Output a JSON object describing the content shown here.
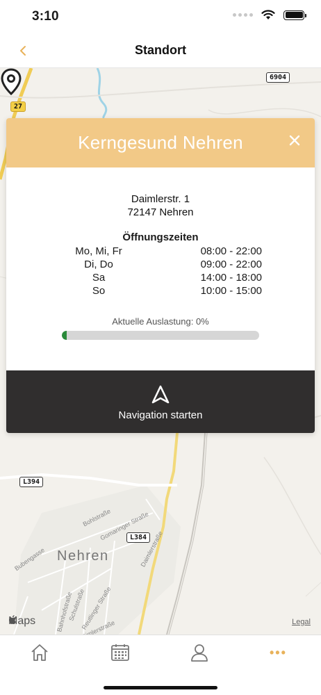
{
  "status": {
    "time": "3:10"
  },
  "nav": {
    "title": "Standort",
    "back_icon": "chevron-left-icon"
  },
  "map": {
    "roads": [
      "27",
      "6904",
      "L394",
      "L384"
    ],
    "town": "Nehren",
    "streets": [
      "Bohlstraße",
      "Gomaringer Straße",
      "Daimlerstraße",
      "Bubengasse",
      "Schulstraße",
      "Reutlinger Straße",
      "Bahnhofstraße",
      "Dimlerstraße"
    ],
    "attribution": "Maps",
    "legal": "Legal"
  },
  "card": {
    "title": "Kerngesund Nehren",
    "address_line1": "Daimlerstr. 1",
    "address_line2": "72147 Nehren",
    "hours_title": "Öffnungszeiten",
    "hours": [
      {
        "day": "Mo, Mi, Fr",
        "time": "08:00 - 22:00"
      },
      {
        "day": "Di, Do",
        "time": "09:00 - 22:00"
      },
      {
        "day": "Sa",
        "time": "14:00 - 18:00"
      },
      {
        "day": "So",
        "time": "10:00 - 15:00"
      }
    ],
    "load_label": "Aktuelle Auslastung: 0%",
    "load_percent": 0,
    "navigation_label": "Navigation starten"
  },
  "tabs": [
    {
      "name": "home",
      "icon": "home-icon"
    },
    {
      "name": "calendar",
      "icon": "calendar-icon"
    },
    {
      "name": "profile",
      "icon": "person-icon"
    },
    {
      "name": "more",
      "icon": "more-icon",
      "label": "•••"
    }
  ],
  "colors": {
    "accent": "#e8b25a",
    "card_header": "#f2c987",
    "nav_button": "#302e2e",
    "load_fill": "#2a8a3a"
  }
}
